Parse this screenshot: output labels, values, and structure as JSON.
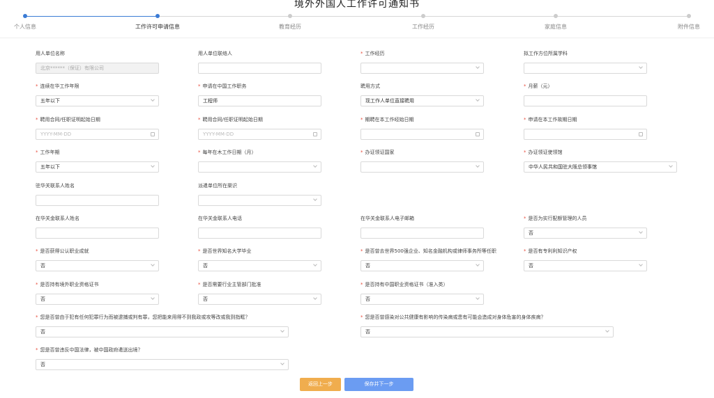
{
  "title": "境外外国人工作许可通知书",
  "steps": [
    "个人信息",
    "工作许可申请信息",
    "教育经历",
    "工作经历",
    "家庭信息",
    "附件信息"
  ],
  "fields": {
    "employer_name": {
      "label": "用人单位名称",
      "value": "北京******（保证）有限公司"
    },
    "employer_contact": {
      "label": "用人单位联络人",
      "value": ""
    },
    "work_experience": {
      "label": "工作经历",
      "value": ""
    },
    "work_location_category": {
      "label": "拟工作方位所属学科",
      "value": ""
    },
    "continuous_years": {
      "label": "连续在华工作年限",
      "value": "五年以下"
    },
    "position": {
      "label": "申请在中国工作职务",
      "value": "工程师"
    },
    "transfer_mode": {
      "label": "聘用方式",
      "value": "现工作人单位直接聘用"
    },
    "monthly_salary": {
      "label": "月薪（元）",
      "value": ""
    },
    "contract_start": {
      "label": "聘用合同/任职证明起始日期",
      "placeholder": "YYYY-MM-DD"
    },
    "contract_end": {
      "label": "聘用合同/任职证明起始日期",
      "placeholder": "YYYY-MM-DD"
    },
    "expected_start": {
      "label": "期聘在本工作经始日期",
      "value": ""
    },
    "expected_end": {
      "label": "申请在本工作故期日期",
      "value": ""
    },
    "work_years": {
      "label": "工作年期",
      "value": "五年以下"
    },
    "annual_days": {
      "label": "每年在木工作日期（月）",
      "value": ""
    },
    "visa_country": {
      "label": "办证领证国家",
      "value": ""
    },
    "visa_consulate": {
      "label": "办证领证使领馆",
      "value": "中华人民共和国驻大阪总领事馆"
    },
    "contact_name_cn": {
      "label": "驻华关联系人姓名",
      "value": ""
    },
    "dispatch_district": {
      "label": "派遣单位所在渠识",
      "value": ""
    },
    "cn_contact_name": {
      "label": "在华关金联系人姓名",
      "value": ""
    },
    "cn_contact_phone": {
      "label": "在华关金联系人电话",
      "value": ""
    },
    "cn_contact_email": {
      "label": "在华关金联系人电子邮箱",
      "value": ""
    },
    "quota_management": {
      "label": "是否为实行配额管理的人员",
      "value": "否"
    },
    "public_achievement": {
      "label": "是否获得公认职业成就",
      "value": "否"
    },
    "famous_university": {
      "label": "是否世界知名大学毕业",
      "value": "否"
    },
    "fortune500": {
      "label": "是否曾去世界500强企业、知名金融机构或律师事务所等任职",
      "value": "否"
    },
    "patents": {
      "label": "是否有专利利知识产权",
      "value": "否"
    },
    "foreign_certificate": {
      "label": "是否持有境外职业资格证书",
      "value": "否"
    },
    "industry_approval": {
      "label": "是否需要行业主管部门批准",
      "value": "否"
    },
    "cn_certificate": {
      "label": "是否持有中国职业资格证书（准入类）",
      "value": "否"
    },
    "criminal_record": {
      "label": "您是否曾由于犯有任何犯罪行为而被逮捕或判有罪，您把能来用得不到我政或攻等改或我到指眶？",
      "value": "否"
    },
    "disease": {
      "label": "您是否曾感染对公共健康有影响的传染病或患有可能会造成对身体危害的身体疾病？",
      "value": "否"
    },
    "deported": {
      "label": "您是否曾违反中国法律，被中国政府遣送出境？",
      "value": "否"
    }
  },
  "buttons": {
    "back": "返回上一步",
    "next": "保存并下一步"
  },
  "colors": {
    "primary": "#3a7bd5",
    "warning": "#f0ad4e",
    "next_button": "#6b9cf2"
  }
}
